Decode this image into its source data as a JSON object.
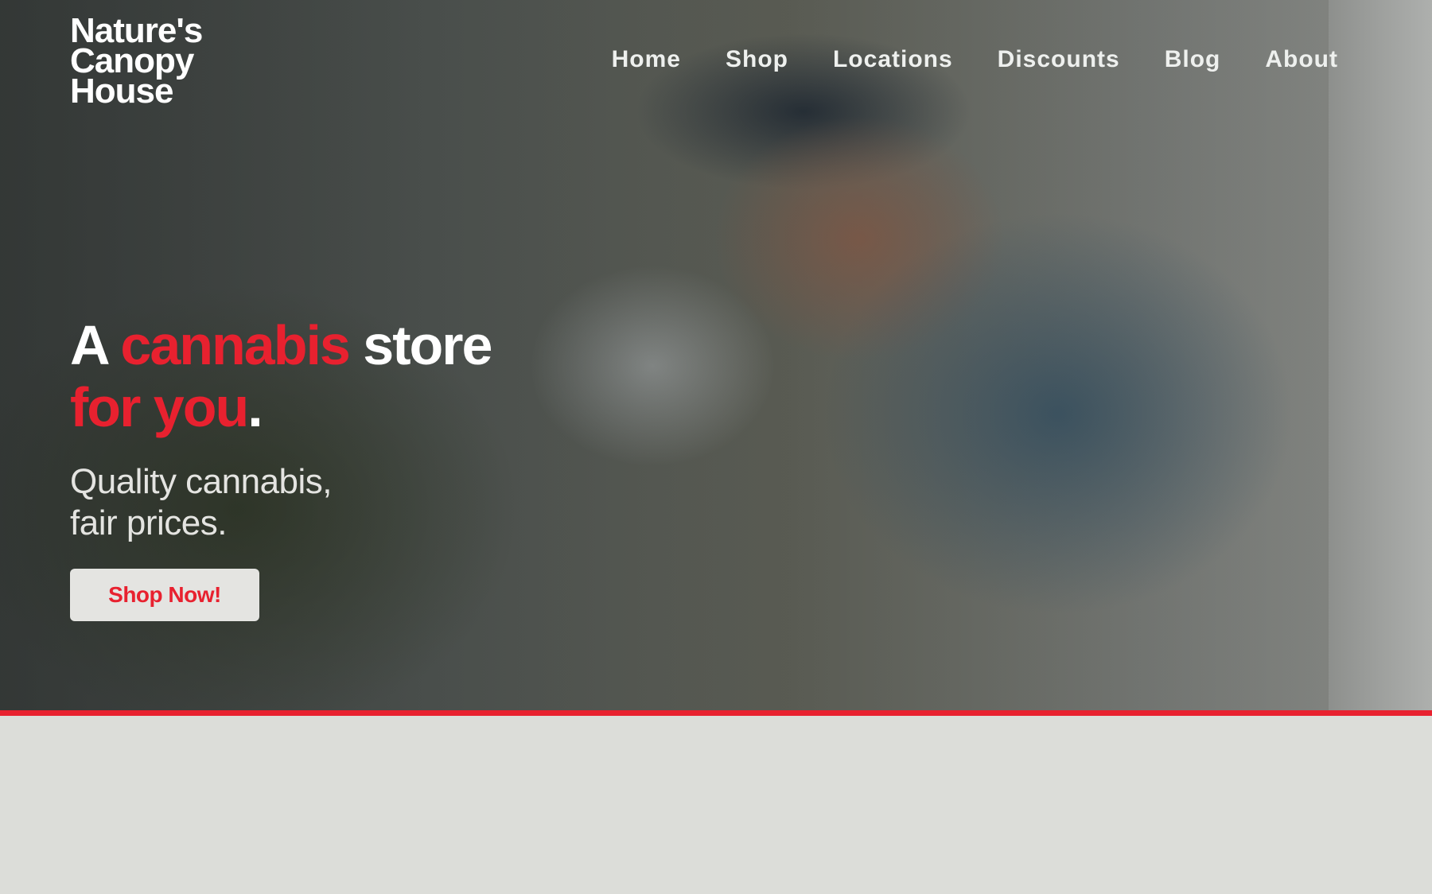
{
  "brand": {
    "logo_lines": [
      "Nature's",
      "Canopy",
      "House"
    ],
    "accent_color": "#e8212f"
  },
  "nav": {
    "items": [
      {
        "label": "Home"
      },
      {
        "label": "Shop"
      },
      {
        "label": "Locations"
      },
      {
        "label": "Discounts"
      },
      {
        "label": "Blog"
      },
      {
        "label": "About"
      }
    ]
  },
  "hero": {
    "headline": {
      "part1": "A ",
      "part2_highlight": "cannabis",
      "part3": " store",
      "part4_highlight": "for you",
      "part5": "."
    },
    "subhead_lines": [
      "Quality cannabis,",
      "fair prices."
    ],
    "cta_label": "Shop Now!"
  }
}
